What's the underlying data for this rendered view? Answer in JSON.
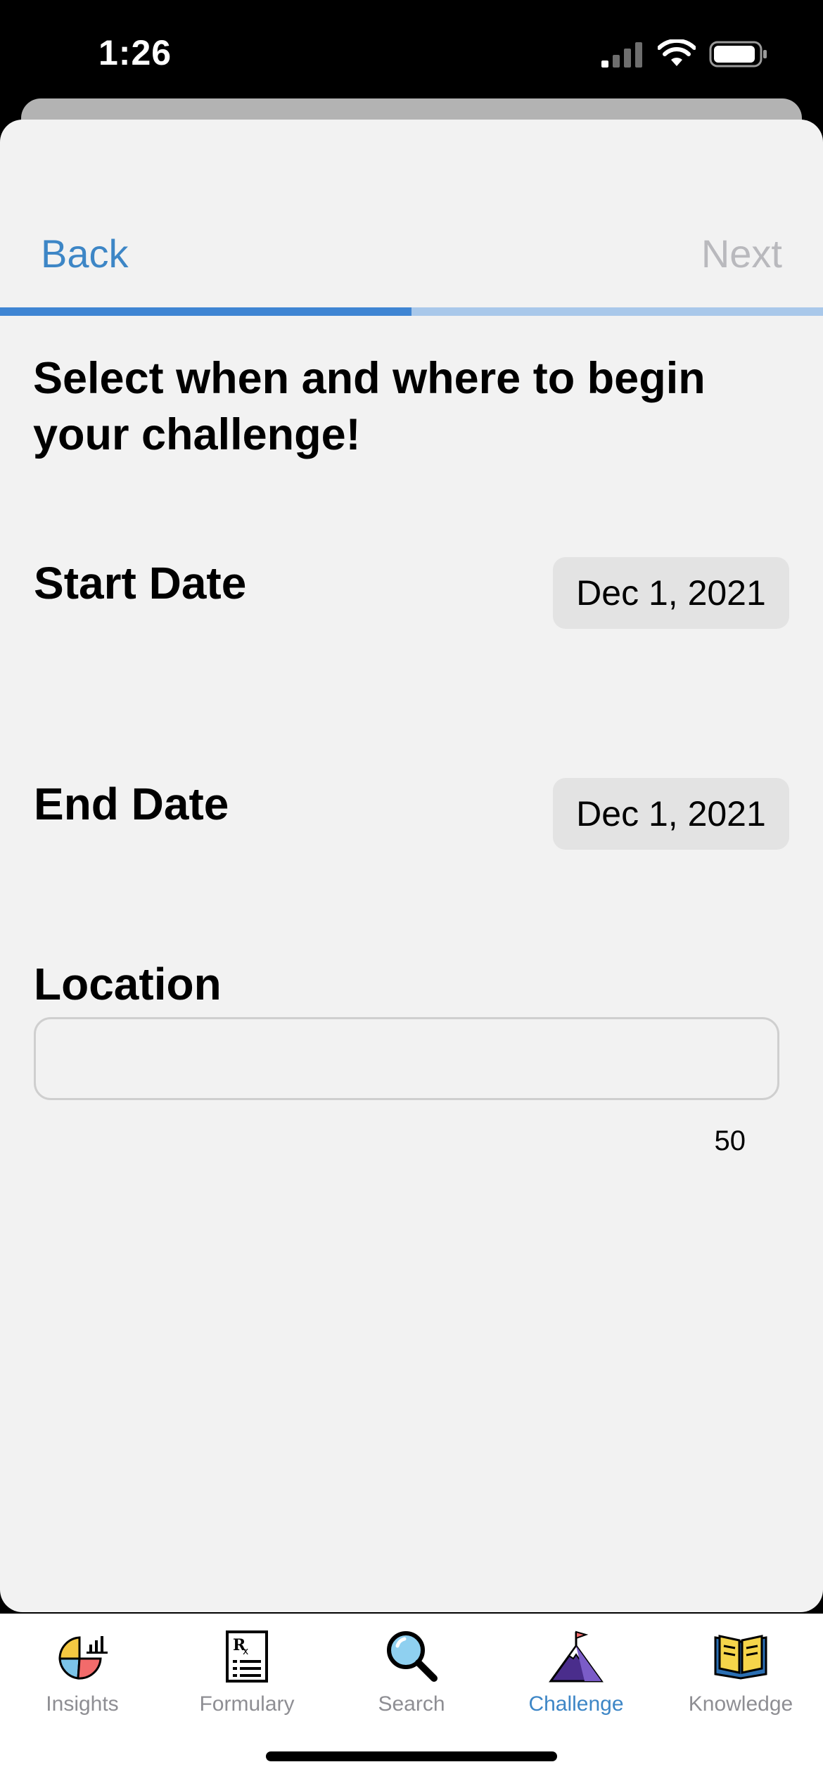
{
  "status_bar": {
    "time": "1:26"
  },
  "nav": {
    "back_label": "Back",
    "next_label": "Next"
  },
  "progress": {
    "fraction": 0.5,
    "fill_color": "#3f85d3",
    "track_color": "#a9c8ea"
  },
  "headline": "Select when and where to begin your challenge!",
  "start_date": {
    "label": "Start Date",
    "value": "Dec 1, 2021"
  },
  "end_date": {
    "label": "End Date",
    "value": "Dec 1, 2021"
  },
  "location": {
    "label": "Location",
    "value": "",
    "char_count": "50"
  },
  "tab_bar": {
    "tabs": [
      {
        "label": "Insights",
        "icon": "pie-chart-icon"
      },
      {
        "label": "Formulary",
        "icon": "prescription-icon"
      },
      {
        "label": "Search",
        "icon": "magnifier-icon"
      },
      {
        "label": "Challenge",
        "icon": "mountain-flag-icon",
        "active": true
      },
      {
        "label": "Knowledge",
        "icon": "book-icon"
      }
    ]
  },
  "colors": {
    "accent": "#3d86c6",
    "sheet_background": "#f2f2f2",
    "date_pill": "#e3e3e3"
  }
}
